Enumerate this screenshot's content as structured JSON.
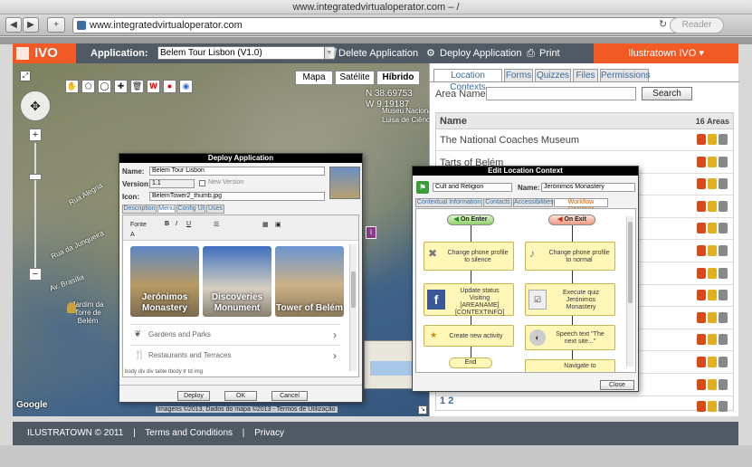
{
  "browser": {
    "title": "www.integratedvirtualoperator.com – /",
    "url": "www.integratedvirtualoperator.com",
    "reader_label": "Reader",
    "back": "◀",
    "forward": "▶",
    "add": "+",
    "reload": "↻"
  },
  "header": {
    "logo": "IVO",
    "application_label": "Application:",
    "application_value": "Belem Tour Lisbon (V1.0)",
    "delete_label": "Delete Application",
    "deploy_label": "Deploy Application",
    "print_label": "Print",
    "user_label": "Ilustratown IVO"
  },
  "map": {
    "types": [
      "Mapa",
      "Satélite",
      "Híbrido"
    ],
    "coord_n": "N 38.69753",
    "coord_w": "W 9.19187",
    "credits": "Imagens ©2013, Dados do mapa ©2013 - Termos de Utilização",
    "google": "Google",
    "labels": [
      "Rua Alegria",
      "Rua da Junqueira",
      "Av. Brasília",
      "Jardim da Torre de Belém",
      "Museu Nacional",
      "Luisa de Ciências"
    ]
  },
  "tabs": [
    "Location Contexts",
    "Forms",
    "Quizzes",
    "Files",
    "Permissions"
  ],
  "search": {
    "label": "Area Name:",
    "button": "Search"
  },
  "areas": {
    "header_name": "Name",
    "header_count": "16 Areas",
    "rows": [
      "The National Coaches Museum",
      "Tarts of Belém"
    ],
    "pager": "1 2"
  },
  "deploy_dialog": {
    "title": "Deploy Application",
    "name_label": "Name:",
    "name_value": "Belem Tour Lisbon",
    "version_label": "Version:",
    "version_value": "1.1",
    "new_version": "New Version",
    "icon_label": "Icon:",
    "icon_value": "BelemTower2_thumb.jpg",
    "subtabs": [
      "Description",
      "Menu",
      "Config UI",
      "Uses"
    ],
    "font_label": "Fonte",
    "tiles": [
      "Jerónimos Monastery",
      "Discoveries Monument",
      "Tower of Belém"
    ],
    "menu_rows": [
      "Gardens and Parks",
      "Restaurants and Terraces"
    ],
    "path": "body div div table tbody tr td img",
    "buttons": [
      "Deploy",
      "OK",
      "Cancel"
    ]
  },
  "edit_dialog": {
    "title": "Edit Location Context",
    "field_value": "Cult and Religion",
    "name_label": "Name:",
    "name_value": "Jerónimos Monastery",
    "subtabs": [
      "Contextual Information",
      "Contacts",
      "Accessibilities",
      "Workflow Designer"
    ],
    "on_enter": "On Enter",
    "on_exit": "On Exit",
    "left_nodes": [
      "Change phone profile to silence",
      "Update status Visiting [AREANAME] [CONTEXTINFO]",
      "Create new activity",
      "End"
    ],
    "right_nodes": [
      "Change phone profile to normal",
      "Execute quiz Jerónimos Monastery",
      "Speech text \"The next site...\"",
      "Navigate to"
    ],
    "close": "Close"
  },
  "footer": {
    "copyright": "ILUSTRATOWN © 2011",
    "sep": "|",
    "terms": "Terms and Conditions",
    "privacy": "Privacy"
  },
  "colors": {
    "brand": "#f15a24",
    "header_bg": "#505a64"
  }
}
